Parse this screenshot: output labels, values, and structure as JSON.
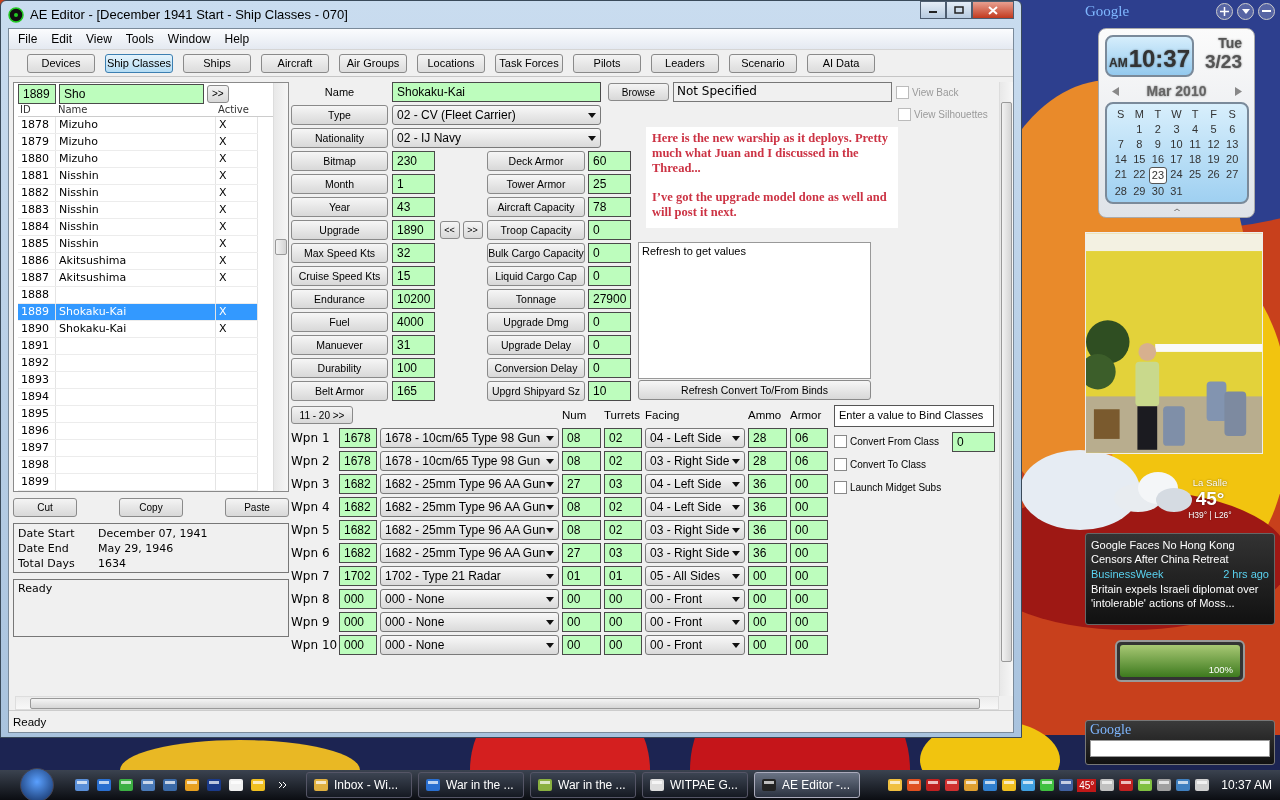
{
  "window": {
    "title": "AE Editor - [December 1941 Start - Ship Classes - 070]"
  },
  "menu": [
    "File",
    "Edit",
    "View",
    "Tools",
    "Window",
    "Help"
  ],
  "toolbar": [
    {
      "label": "Devices",
      "selected": false
    },
    {
      "label": "Ship Classes",
      "selected": true
    },
    {
      "label": "Ships",
      "selected": false
    },
    {
      "label": "Aircraft",
      "selected": false
    },
    {
      "label": "Air Groups",
      "selected": false
    },
    {
      "label": "Locations",
      "selected": false
    },
    {
      "label": "Task Forces",
      "selected": false
    },
    {
      "label": "Pilots",
      "selected": false
    },
    {
      "label": "Leaders",
      "selected": false
    },
    {
      "label": "Scenario",
      "selected": false
    },
    {
      "label": "AI Data",
      "selected": false
    }
  ],
  "list": {
    "search_id": "1889",
    "search_name": "Sho",
    "go": ">>",
    "columns": [
      "ID",
      "Name",
      "Active"
    ],
    "rows": [
      {
        "id": "1878",
        "name": "Mizuho",
        "active": "X",
        "selected": false
      },
      {
        "id": "1879",
        "name": "Mizuho",
        "active": "X",
        "selected": false
      },
      {
        "id": "1880",
        "name": "Mizuho",
        "active": "X",
        "selected": false
      },
      {
        "id": "1881",
        "name": "Nisshin",
        "active": "X",
        "selected": false
      },
      {
        "id": "1882",
        "name": "Nisshin",
        "active": "X",
        "selected": false
      },
      {
        "id": "1883",
        "name": "Nisshin",
        "active": "X",
        "selected": false
      },
      {
        "id": "1884",
        "name": "Nisshin",
        "active": "X",
        "selected": false
      },
      {
        "id": "1885",
        "name": "Nisshin",
        "active": "X",
        "selected": false
      },
      {
        "id": "1886",
        "name": "Akitsushima",
        "active": "X",
        "selected": false
      },
      {
        "id": "1887",
        "name": "Akitsushima",
        "active": "X",
        "selected": false
      },
      {
        "id": "1888",
        "selected": false
      },
      {
        "id": "1889",
        "name": "Shokaku-Kai",
        "active": "X",
        "selected": true
      },
      {
        "id": "1890",
        "name": "Shokaku-Kai",
        "active": "X",
        "selected": false
      },
      {
        "id": "1891",
        "selected": false
      },
      {
        "id": "1892",
        "selected": false
      },
      {
        "id": "1893",
        "selected": false
      },
      {
        "id": "1894",
        "selected": false
      },
      {
        "id": "1895",
        "selected": false
      },
      {
        "id": "1896",
        "selected": false
      },
      {
        "id": "1897",
        "selected": false
      },
      {
        "id": "1898",
        "selected": false
      },
      {
        "id": "1899",
        "selected": false
      }
    ]
  },
  "clipboard_buttons": [
    "Cut",
    "Copy",
    "Paste"
  ],
  "dates": [
    {
      "label": "Date Start",
      "value": "December 07, 1941"
    },
    {
      "label": "Date End",
      "value": "May 29, 1946"
    },
    {
      "label": "Total Days",
      "value": "1634"
    }
  ],
  "log": "Ready",
  "form": {
    "name_label": "Name",
    "name": "Shokaku-Kai",
    "browse": "Browse",
    "bitmap_file": "Not Specified",
    "view_options": [
      {
        "label": "View Back",
        "checked": false,
        "disabled": true
      },
      {
        "label": "View Silhouettes",
        "checked": false,
        "disabled": true
      }
    ],
    "type": {
      "label": "Type",
      "value": "02 - CV (Fleet Carrier)"
    },
    "nationality": {
      "label": "Nationality",
      "value": "02 - IJ Navy"
    },
    "left_fields": [
      {
        "label": "Bitmap",
        "value": "230"
      },
      {
        "label": "Month",
        "value": "1"
      },
      {
        "label": "Year",
        "value": "43"
      },
      {
        "label": "Upgrade",
        "value": "1890",
        "nav": [
          "<<",
          ">>"
        ]
      },
      {
        "label": "Max Speed Kts",
        "value": "32"
      },
      {
        "label": "Cruise Speed Kts",
        "value": "15"
      },
      {
        "label": "Endurance",
        "value": "10200"
      },
      {
        "label": "Fuel",
        "value": "4000"
      },
      {
        "label": "Manuever",
        "value": "31"
      },
      {
        "label": "Durability",
        "value": "100"
      },
      {
        "label": "Belt Armor",
        "value": "165"
      }
    ],
    "right_fields": [
      {
        "label": "Deck Armor",
        "value": "60"
      },
      {
        "label": "Tower Armor",
        "value": "25"
      },
      {
        "label": "Aircraft Capacity",
        "value": "78"
      },
      {
        "label": "Troop Capacity",
        "value": "0"
      },
      {
        "label": "Bulk Cargo Capacity",
        "value": "0"
      },
      {
        "label": "Liquid Cargo Cap",
        "value": "0"
      },
      {
        "label": "Tonnage",
        "value": "27900"
      },
      {
        "label": "Upgrade Dmg",
        "value": "0"
      },
      {
        "label": "Upgrade Delay",
        "value": "0"
      },
      {
        "label": "Conversion Delay",
        "value": "0"
      },
      {
        "label": "Upgrd Shipyard Sz",
        "value": "10"
      }
    ],
    "note": [
      "Here is the new warship as it deploys. Pretty much what Juan and I discussed in the Thread...",
      "I’ve got the upgrade model done as well and will post it next."
    ],
    "values_box": "Refresh to get values",
    "refresh_button": "Refresh Convert To/From Binds"
  },
  "weapons": {
    "page_button": "11 - 20 >>",
    "columns": [
      "Num",
      "Turrets",
      "Facing",
      "Ammo",
      "Armor"
    ],
    "rows": [
      {
        "label": "Wpn 1",
        "id": "1678",
        "device": "1678 - 10cm/65 Type 98 Gun",
        "num": "08",
        "turrets": "02",
        "facing": "04 - Left Side",
        "ammo": "28",
        "armor": "06"
      },
      {
        "label": "Wpn 2",
        "id": "1678",
        "device": "1678 - 10cm/65 Type 98 Gun",
        "num": "08",
        "turrets": "02",
        "facing": "03 - Right Side",
        "ammo": "28",
        "armor": "06"
      },
      {
        "label": "Wpn 3",
        "id": "1682",
        "device": "1682 - 25mm Type 96 AA Gun",
        "num": "27",
        "turrets": "03",
        "facing": "04 - Left Side",
        "ammo": "36",
        "armor": "00"
      },
      {
        "label": "Wpn 4",
        "id": "1682",
        "device": "1682 - 25mm Type 96 AA Gun",
        "num": "08",
        "turrets": "02",
        "facing": "04 - Left Side",
        "ammo": "36",
        "armor": "00"
      },
      {
        "label": "Wpn 5",
        "id": "1682",
        "device": "1682 - 25mm Type 96 AA Gun",
        "num": "08",
        "turrets": "02",
        "facing": "03 - Right Side",
        "ammo": "36",
        "armor": "00"
      },
      {
        "label": "Wpn 6",
        "id": "1682",
        "device": "1682 - 25mm Type 96 AA Gun",
        "num": "27",
        "turrets": "03",
        "facing": "03 - Right Side",
        "ammo": "36",
        "armor": "00"
      },
      {
        "label": "Wpn 7",
        "id": "1702",
        "device": "1702 - Type 21 Radar",
        "num": "01",
        "turrets": "01",
        "facing": "05 - All Sides",
        "ammo": "00",
        "armor": "00"
      },
      {
        "label": "Wpn 8",
        "id": "000",
        "device": "000 - None",
        "num": "00",
        "turrets": "00",
        "facing": "00 - Front",
        "ammo": "00",
        "armor": "00"
      },
      {
        "label": "Wpn 9",
        "id": "000",
        "device": "000 - None",
        "num": "00",
        "turrets": "00",
        "facing": "00 - Front",
        "ammo": "00",
        "armor": "00"
      },
      {
        "label": "Wpn 10",
        "id": "000",
        "device": "000 - None",
        "num": "00",
        "turrets": "00",
        "facing": "00 - Front",
        "ammo": "00",
        "armor": "00"
      }
    ]
  },
  "bind": {
    "heading": "Enter a value to Bind Classes",
    "class_value": "0",
    "options": [
      {
        "label": "Convert From Class",
        "checked": false
      },
      {
        "label": "Convert To Class",
        "checked": false
      },
      {
        "label": "Launch Midget Subs",
        "checked": false
      }
    ]
  },
  "status_bar": "Ready",
  "gadgets": {
    "header": "Google",
    "clock": {
      "ampm": "AM",
      "time": "10:37",
      "day": "Tue",
      "date": "3/23"
    },
    "calendar": {
      "month": "Mar 2010",
      "weekdays": [
        "S",
        "M",
        "T",
        "W",
        "T",
        "F",
        "S"
      ],
      "weeks": [
        [
          {
            "day": "1",
            "selected": false
          },
          {
            "day": "2",
            "selected": false
          },
          {
            "day": "3",
            "selected": false
          },
          {
            "day": "4",
            "selected": false
          },
          {
            "day": "5",
            "selected": false
          },
          {
            "day": "6",
            "selected": false
          }
        ],
        [
          {
            "day": "7",
            "selected": false
          },
          {
            "day": "8",
            "selected": false
          },
          {
            "day": "9",
            "selected": false
          },
          {
            "day": "10",
            "selected": false
          },
          {
            "day": "11",
            "selected": false
          },
          {
            "day": "12",
            "selected": false
          },
          {
            "day": "13",
            "selected": false
          }
        ],
        [
          {
            "day": "14",
            "selected": false
          },
          {
            "day": "15",
            "selected": false
          },
          {
            "day": "16",
            "selected": false
          },
          {
            "day": "17",
            "selected": false
          },
          {
            "day": "18",
            "selected": false
          },
          {
            "day": "19",
            "selected": false
          },
          {
            "day": "20",
            "selected": false
          }
        ],
        [
          {
            "day": "21",
            "selected": false
          },
          {
            "day": "22",
            "selected": false
          },
          {
            "day": "23",
            "selected": true
          },
          {
            "day": "24",
            "selected": false
          },
          {
            "day": "25",
            "selected": false
          },
          {
            "day": "26",
            "selected": false
          },
          {
            "day": "27",
            "selected": false
          }
        ],
        [
          {
            "day": "28",
            "selected": false
          },
          {
            "day": "29",
            "selected": false
          },
          {
            "day": "30",
            "selected": false
          },
          {
            "day": "31",
            "selected": false
          }
        ]
      ]
    },
    "weather": {
      "place": "La Salle",
      "temp": "45°",
      "range": "H39° | L26°"
    },
    "news": [
      {
        "headline": "Google Faces No Hong Kong Censors After China Retreat",
        "source": "BusinessWeek",
        "time": "2 hrs ago"
      },
      {
        "headline": "Britain expels Israeli diplomat over 'intolerable' actions of Moss..."
      }
    ],
    "battery": {
      "level": 1,
      "reading": "100%"
    },
    "search": {
      "logo": "Google"
    }
  },
  "taskbar": {
    "tasks": [
      {
        "label": "Inbox - Wi...",
        "selected": false
      },
      {
        "label": "War in the ...",
        "selected": false
      },
      {
        "label": "War in the ...",
        "selected": false
      },
      {
        "label": "WITPAE G...",
        "selected": false
      },
      {
        "label": "AE Editor -...",
        "selected": true
      }
    ],
    "tray_temp": "45°",
    "clock": "10:37 AM"
  }
}
